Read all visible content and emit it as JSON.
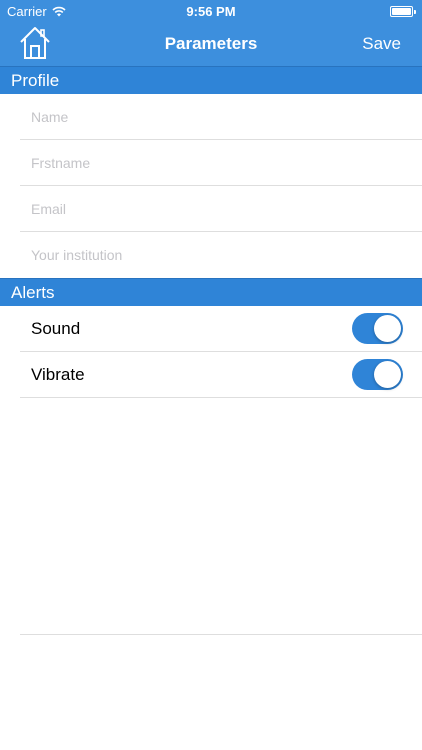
{
  "status_bar": {
    "carrier": "Carrier",
    "time": "9:56 PM"
  },
  "nav": {
    "title": "Parameters",
    "save_label": "Save",
    "home_icon": "home-icon"
  },
  "profile": {
    "header": "Profile",
    "fields": [
      {
        "placeholder": "Name"
      },
      {
        "placeholder": "Frstname"
      },
      {
        "placeholder": "Email"
      },
      {
        "placeholder": "Your institution"
      }
    ]
  },
  "alerts": {
    "header": "Alerts",
    "items": [
      {
        "label": "Sound",
        "on": true
      },
      {
        "label": "Vibrate",
        "on": true
      }
    ]
  },
  "colors": {
    "accent": "#3d8fdd",
    "section": "#2f84d7"
  }
}
